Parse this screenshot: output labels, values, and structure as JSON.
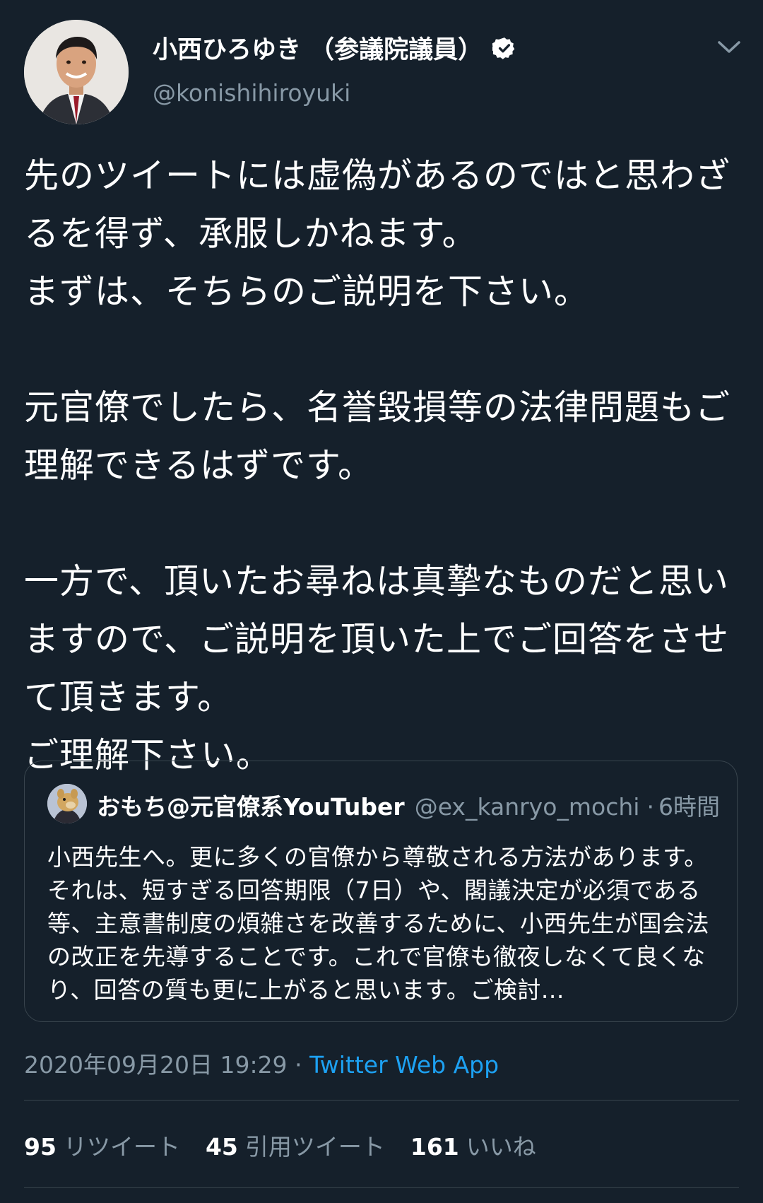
{
  "tweet": {
    "author": {
      "name": "小西ひろゆき （参議院議員）",
      "handle": "@konishihiroyuki",
      "verified": true
    },
    "text": "先のツイートには虚偽があるのではと思わざるを得ず、承服しかねます。\nまずは、そちらのご説明を下さい。\n\n元官僚でしたら、名誉毀損等の法律問題もご理解できるはずです。\n\n一方で、頂いたお尋ねは真摯なものだと思いますので、ご説明を頂いた上でご回答をさせて頂きます。\nご理解下さい。",
    "timestamp": "2020年09月20日 19:29",
    "separator": "·",
    "source_app": "Twitter Web App"
  },
  "quoted_tweet": {
    "name": "おもち@元官僚系YouTuber",
    "handle": "@ex_kanryo_mochi",
    "separator": "·",
    "time": "6時間",
    "text": "小西先生へ。更に多くの官僚から尊敬される方法があります。それは、短すぎる回答期限（7日）や、閣議決定が必須である等、主意書制度の煩雑さを改善するために、小西先生が国会法の改正を先導することです。これで官僚も徹夜しなくて良くなり、回答の質も更に上がると思います。ご検討..."
  },
  "stats": {
    "retweets": {
      "count": "95",
      "label": "リツイート"
    },
    "quote_tweets": {
      "count": "45",
      "label": "引用ツイート"
    },
    "likes": {
      "count": "161",
      "label": "いいね"
    }
  },
  "colors": {
    "background": "#15202b",
    "secondary_text": "#8899a6",
    "link": "#1da1f2",
    "border": "#38444d"
  },
  "icons": {
    "verified": "verified-badge-icon",
    "more": "chevron-down-icon"
  }
}
